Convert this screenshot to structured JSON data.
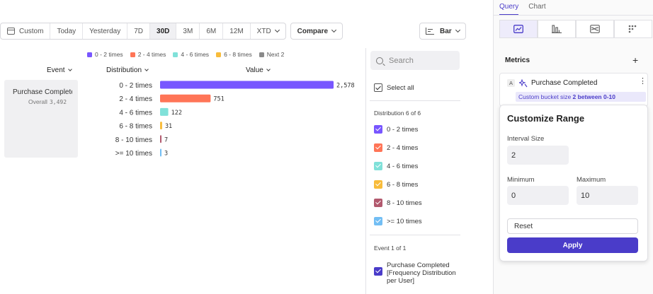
{
  "toolbar": {
    "custom_label": "Custom",
    "ranges": [
      "Today",
      "Yesterday",
      "7D",
      "30D",
      "3M",
      "6M",
      "12M",
      "XTD"
    ],
    "active_range": "30D",
    "compare_label": "Compare",
    "chart_type_label": "Bar"
  },
  "table": {
    "event_header": "Event",
    "distribution_header": "Distribution",
    "value_header": "Value",
    "event_name": "Purchase Completed",
    "overall_label": "Overall",
    "overall_value": "3,492"
  },
  "chart_data": {
    "type": "bar",
    "orientation": "horizontal",
    "categories": [
      "0 - 2 times",
      "2 - 4 times",
      "4 - 6 times",
      "6 - 8 times",
      "8 - 10 times",
      ">= 10 times"
    ],
    "values": [
      2578,
      751,
      122,
      31,
      7,
      3
    ],
    "value_labels": [
      "2,578",
      "751",
      "122",
      "31",
      "7",
      "3"
    ],
    "colors": [
      "#7856ff",
      "#ff7557",
      "#80e1d9",
      "#f8bc3b",
      "#b2596e",
      "#72bef4"
    ],
    "xlim": [
      0,
      2578
    ],
    "legend": {
      "position": "top",
      "entries": [
        {
          "label": "0 - 2 times",
          "color": "#7856ff"
        },
        {
          "label": "2 - 4 times",
          "color": "#ff7557"
        },
        {
          "label": "4 - 6 times",
          "color": "#80e1d9"
        },
        {
          "label": "6 - 8 times",
          "color": "#f8bc3b"
        },
        {
          "label": "Next 2",
          "color": "#8a8a8a"
        }
      ]
    },
    "grid": false
  },
  "filter": {
    "search_placeholder": "Search",
    "select_all_label": "Select all",
    "distribution_heading": "Distribution 6 of 6",
    "items": [
      {
        "label": "0 - 2 times",
        "color": "#7856ff"
      },
      {
        "label": "2 - 4 times",
        "color": "#ff7557"
      },
      {
        "label": "4 - 6 times",
        "color": "#80e1d9"
      },
      {
        "label": "6 - 8 times",
        "color": "#f8bc3b"
      },
      {
        "label": "8 - 10 times",
        "color": "#b2596e"
      },
      {
        "label": ">= 10 times",
        "color": "#72bef4"
      }
    ],
    "event_heading": "Event 1 of 1",
    "event_item_label": "Purchase Completed [Frequency Distribution per User]",
    "event_item_color": "#4a3cc9"
  },
  "panel": {
    "tabs": [
      "Query",
      "Chart"
    ],
    "active_tab": "Query",
    "tools": [
      "insights-icon",
      "funnels-icon",
      "flows-icon",
      "retention-icon"
    ],
    "metrics_title": "Metrics",
    "metric_letter": "A",
    "metric_name": "Purchase Completed",
    "bucket_text_prefix": "Custom bucket size ",
    "bucket_text_value": "2 between 0-10",
    "popover": {
      "title": "Customize Range",
      "interval_label": "Interval Size",
      "interval_value": "2",
      "min_label": "Minimum",
      "min_value": "0",
      "max_label": "Maximum",
      "max_value": "10",
      "reset_label": "Reset",
      "apply_label": "Apply"
    }
  },
  "colors": {
    "accent": "#4a3cc9"
  }
}
